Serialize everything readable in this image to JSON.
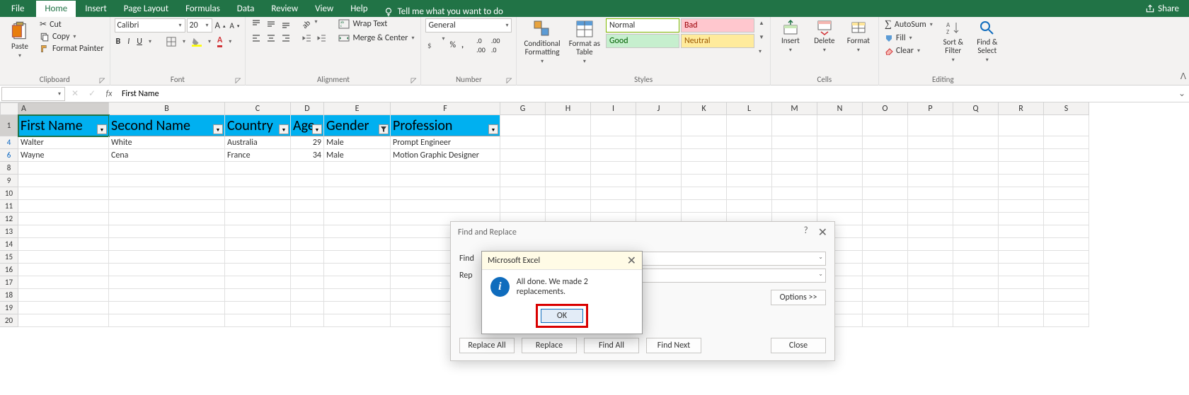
{
  "menu": {
    "file": "File",
    "home": "Home",
    "insert": "Insert",
    "page_layout": "Page Layout",
    "formulas": "Formulas",
    "data": "Data",
    "review": "Review",
    "view": "View",
    "help": "Help",
    "tellme": "Tell me what you want to do",
    "share": "Share"
  },
  "ribbon": {
    "clipboard": {
      "label": "Clipboard",
      "paste": "Paste",
      "cut": "Cut",
      "copy": "Copy",
      "format_painter": "Format Painter"
    },
    "font": {
      "label": "Font",
      "name": "Calibri",
      "size": "20",
      "bold": "B",
      "italic": "I",
      "underline": "U"
    },
    "alignment": {
      "label": "Alignment",
      "wrap": "Wrap Text",
      "merge": "Merge & Center"
    },
    "number": {
      "label": "Number",
      "format": "General"
    },
    "styles": {
      "label": "Styles",
      "cond": "Conditional\nFormatting",
      "fat": "Format as\nTable",
      "normal": "Normal",
      "bad": "Bad",
      "good": "Good",
      "neutral": "Neutral"
    },
    "cells": {
      "label": "Cells",
      "insert": "Insert",
      "delete": "Delete",
      "format": "Format"
    },
    "editing": {
      "label": "Editing",
      "autosum": "AutoSum",
      "fill": "Fill",
      "clear": "Clear",
      "sort": "Sort &\nFilter",
      "find": "Find &\nSelect"
    }
  },
  "formula_bar": {
    "namebox": "",
    "fx": "fx",
    "value": "First Name"
  },
  "columns": [
    "A",
    "B",
    "C",
    "D",
    "E",
    "F",
    "G",
    "H",
    "I",
    "J",
    "K",
    "L",
    "M",
    "N",
    "O",
    "P",
    "Q",
    "R",
    "S"
  ],
  "headers": {
    "A": "First Name",
    "B": "Second Name",
    "C": "Country",
    "D": "Age",
    "E": "Gender",
    "F": "Profession"
  },
  "rows": [
    {
      "n": "4",
      "A": "Walter",
      "B": "White",
      "C": "Australia",
      "D": "29",
      "E": "Male",
      "F": "Prompt Engineer"
    },
    {
      "n": "6",
      "A": "Wayne",
      "B": "Cena",
      "C": "France",
      "D": "34",
      "E": "Male",
      "F": "Motion Graphic Designer"
    }
  ],
  "blank_rows": [
    "8",
    "9",
    "10",
    "11",
    "12",
    "13",
    "14",
    "15",
    "16",
    "17",
    "18",
    "19",
    "20"
  ],
  "find_replace": {
    "title": "Find and Replace",
    "find_label": "Find",
    "replace_label": "Rep",
    "options": "Options >>",
    "replace_all": "Replace All",
    "replace": "Replace",
    "find_all": "Find All",
    "find_next": "Find Next",
    "close": "Close"
  },
  "msgbox": {
    "title": "Microsoft Excel",
    "text": "All done. We made 2 replacements.",
    "ok": "OK"
  }
}
